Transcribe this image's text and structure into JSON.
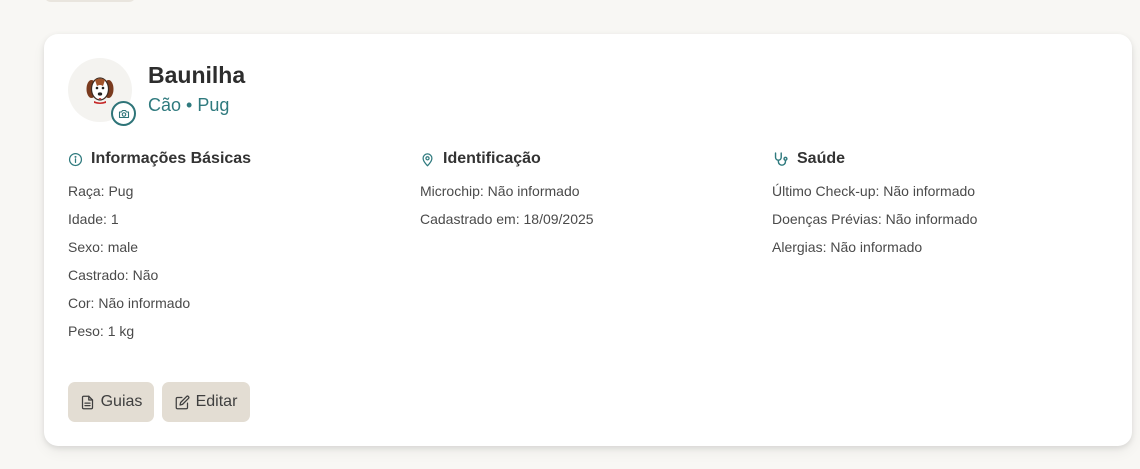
{
  "pet": {
    "name": "Baunilha",
    "subtitle": "Cão • Pug"
  },
  "icons": {
    "avatar": "dog-face-icon",
    "camera": "camera-icon",
    "info": "info-circle-icon",
    "location": "map-pin-icon",
    "health": "stethoscope-icon",
    "guias": "document-icon",
    "editar": "edit-icon"
  },
  "colors": {
    "accent": "#2f7a7e",
    "button_bg": "#e3ddd3",
    "card_bg": "#ffffff",
    "page_bg": "#f8f7f4"
  },
  "sections": {
    "basic": {
      "title": "Informações Básicas",
      "rows": [
        "Raça: Pug",
        "Idade: 1",
        "Sexo: male",
        "Castrado: Não",
        "Cor: Não informado",
        "Peso: 1 kg"
      ]
    },
    "identification": {
      "title": "Identificação",
      "rows": [
        "Microchip: Não informado",
        "Cadastrado em: 18/09/2025"
      ]
    },
    "health": {
      "title": "Saúde",
      "rows": [
        "Último Check-up: Não informado",
        "Doenças Prévias: Não informado",
        "Alergias: Não informado"
      ]
    }
  },
  "actions": {
    "guias_label": "Guias",
    "editar_label": "Editar"
  }
}
